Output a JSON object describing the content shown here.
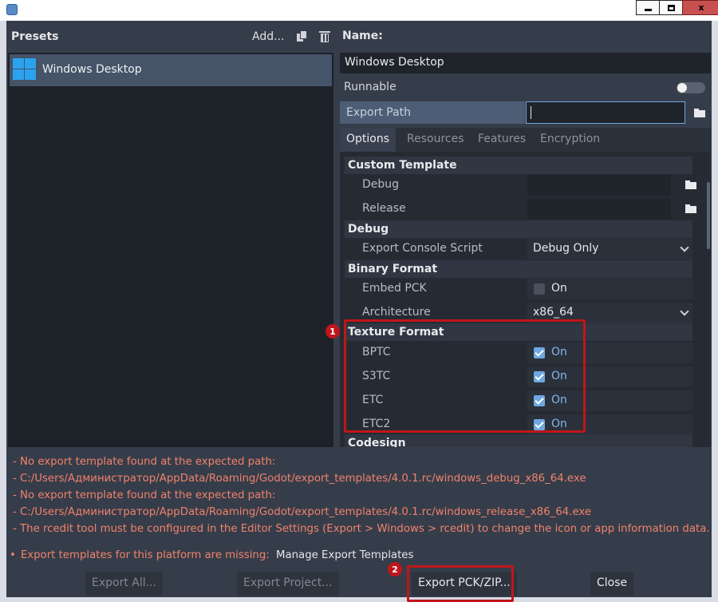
{
  "titlebar": {
    "min_label": "_",
    "close_label": "x"
  },
  "presets": {
    "header": "Presets",
    "add_label": "Add...",
    "items": [
      {
        "label": "Windows Desktop",
        "icon": "windows-logo-icon"
      }
    ]
  },
  "details": {
    "name_label": "Name:",
    "name_value": "Windows Desktop",
    "runnable_label": "Runnable",
    "export_path_label": "Export Path",
    "export_path_value": "",
    "tabs": [
      "Options",
      "Resources",
      "Features",
      "Encryption"
    ]
  },
  "options": {
    "custom_template": {
      "title": "Custom Template",
      "debug_label": "Debug",
      "release_label": "Release"
    },
    "debug": {
      "title": "Debug",
      "export_console_script_label": "Export Console Script",
      "export_console_script_value": "Debug Only"
    },
    "binary_format": {
      "title": "Binary Format",
      "embed_pck_label": "Embed PCK",
      "embed_pck_value": "On",
      "architecture_label": "Architecture",
      "architecture_value": "x86_64"
    },
    "texture_format": {
      "title": "Texture Format",
      "bptc_label": "BPTC",
      "bptc_value": "On",
      "s3tc_label": "S3TC",
      "s3tc_value": "On",
      "etc_label": "ETC",
      "etc_value": "On",
      "etc2_label": "ETC2",
      "etc2_value": "On"
    },
    "codesign": {
      "title": "Codesign"
    }
  },
  "annotations": {
    "badge1": "1",
    "badge2": "2"
  },
  "errors": [
    "- No export template found at the expected path:",
    "- C:/Users/Администратор/AppData/Roaming/Godot/export_templates/4.0.1.rc/windows_debug_x86_64.exe",
    "- No export template found at the expected path:",
    "- C:/Users/Администратор/AppData/Roaming/Godot/export_templates/4.0.1.rc/windows_release_x86_64.exe",
    "- The rcedit tool must be configured in the Editor Settings (Export > Windows > rcedit) to change the icon or app information data."
  ],
  "missing": {
    "bullet": "•",
    "message": "Export templates for this platform are missing:",
    "manage_label": "Manage Export Templates"
  },
  "buttons": {
    "export_all": "Export All...",
    "export_project": "Export Project...",
    "export_pck": "Export PCK/ZIP...",
    "close": "Close"
  },
  "colors": {
    "background": "#363d4a",
    "accent": "#6fa7e0",
    "error": "#f0826b",
    "highlight": "#c0151b",
    "selected": "#455468"
  }
}
